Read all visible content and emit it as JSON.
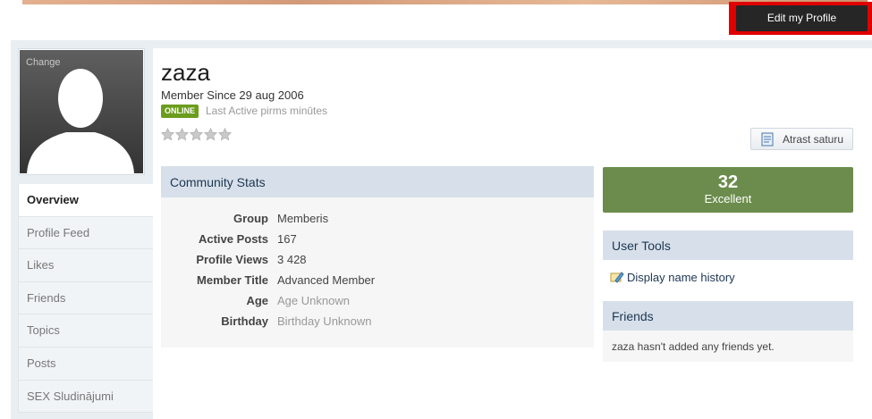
{
  "header": {
    "edit_profile_label": "Edit my Profile"
  },
  "profile": {
    "name": "zaza",
    "member_since": "Member Since 29 aug 2006",
    "online_badge": "ONLINE",
    "last_active": "Last Active pirms minūtes",
    "change_photo_label": "Change",
    "rating_stars": 0,
    "rating_max": 5,
    "report_label": "Atrast saturu"
  },
  "tabs": [
    {
      "label": "Overview"
    },
    {
      "label": "Profile Feed"
    },
    {
      "label": "Likes"
    },
    {
      "label": "Friends"
    },
    {
      "label": "Topics"
    },
    {
      "label": "Posts"
    },
    {
      "label": "SEX Sludinājumi"
    }
  ],
  "community_stats": {
    "title": "Community Stats",
    "rows": [
      {
        "key": "Group",
        "value": "Memberis"
      },
      {
        "key": "Active Posts",
        "value": "167"
      },
      {
        "key": "Profile Views",
        "value": "3 428"
      },
      {
        "key": "Member Title",
        "value": "Advanced Member"
      },
      {
        "key": "Age",
        "value": "Age Unknown"
      },
      {
        "key": "Birthday",
        "value": "Birthday Unknown"
      }
    ]
  },
  "reputation": {
    "value": "32",
    "label": "Excellent",
    "color": "#6b8c4c"
  },
  "user_tools": {
    "title": "User Tools",
    "display_name_history": "Display name history"
  },
  "friends": {
    "title": "Friends",
    "empty_text": "zaza hasn't added any friends yet."
  },
  "colors": {
    "accent": "#1d3652",
    "online": "#6b9c1e",
    "highlight": "#e00000"
  }
}
